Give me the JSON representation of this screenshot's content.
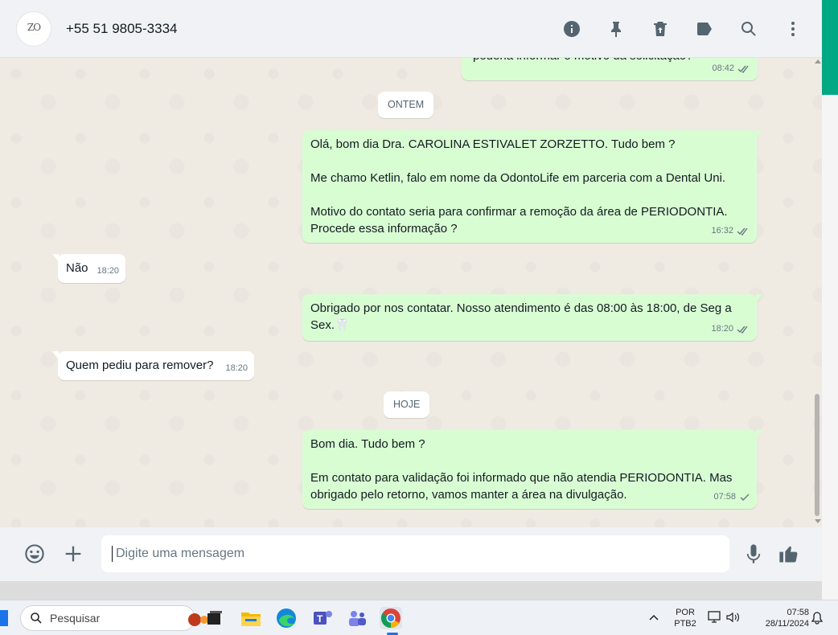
{
  "header": {
    "contact_name": "+55 51 9805-3334",
    "avatar_monogram": "ZO",
    "icons": [
      "info-icon",
      "pin-icon",
      "delete-icon",
      "label-icon",
      "search-icon",
      "more-icon"
    ]
  },
  "messages": [
    {
      "direction": "out",
      "text": "poderia informar o motivo da solicitação?",
      "time": "08:42",
      "status": "read"
    },
    {
      "type": "day",
      "label": "ONTEM"
    },
    {
      "direction": "out",
      "text": "Olá, bom dia Dra. CAROLINA ESTIVALET ZORZETTO. Tudo bem ?\n\nMe chamo Ketlin, falo em nome da OdontoLife em parceria com a Dental Uni.\n\nMotivo do contato seria para confirmar a remoção da área de PERIODONTIA.\nProcede essa informação ?",
      "time": "16:32",
      "status": "read"
    },
    {
      "direction": "in",
      "text": "Não",
      "time": "18:20"
    },
    {
      "direction": "out",
      "text": "Obrigado por nos contatar. Nosso atendimento é das 08:00 às 18:00, de Seg a\nSex.🦷",
      "time": "18:20",
      "status": "read"
    },
    {
      "direction": "in",
      "text": "Quem pediu para remover?",
      "time": "18:20"
    },
    {
      "type": "day",
      "label": "HOJE"
    },
    {
      "direction": "out",
      "text": "Bom dia. Tudo bem ?\n\nEm contato para validação foi informado que não atendia PERIODONTIA. Mas\nobrigado pelo retorno, vamos manter a área na divulgação.",
      "time": "07:58",
      "status": "sent"
    }
  ],
  "composer": {
    "placeholder": "Digite uma mensagem",
    "icons": [
      "emoji-icon",
      "plus-icon",
      "mic-icon",
      "thumbs-up-icon"
    ]
  },
  "taskbar": {
    "search_placeholder": "Pesquisar",
    "apps": [
      "task-view-icon",
      "file-explorer-icon",
      "edge-icon",
      "teams-icon",
      "teams-classic-icon",
      "chrome-icon"
    ],
    "language": "POR",
    "keyboard": "PTB2",
    "time": "07:58",
    "date": "28/11/2024"
  },
  "colors": {
    "outgoing_bubble": "#d9fdd3",
    "incoming_bubble": "#ffffff",
    "chat_background": "#efeae2",
    "accent": "#00a884",
    "read_tick": "#667781"
  }
}
